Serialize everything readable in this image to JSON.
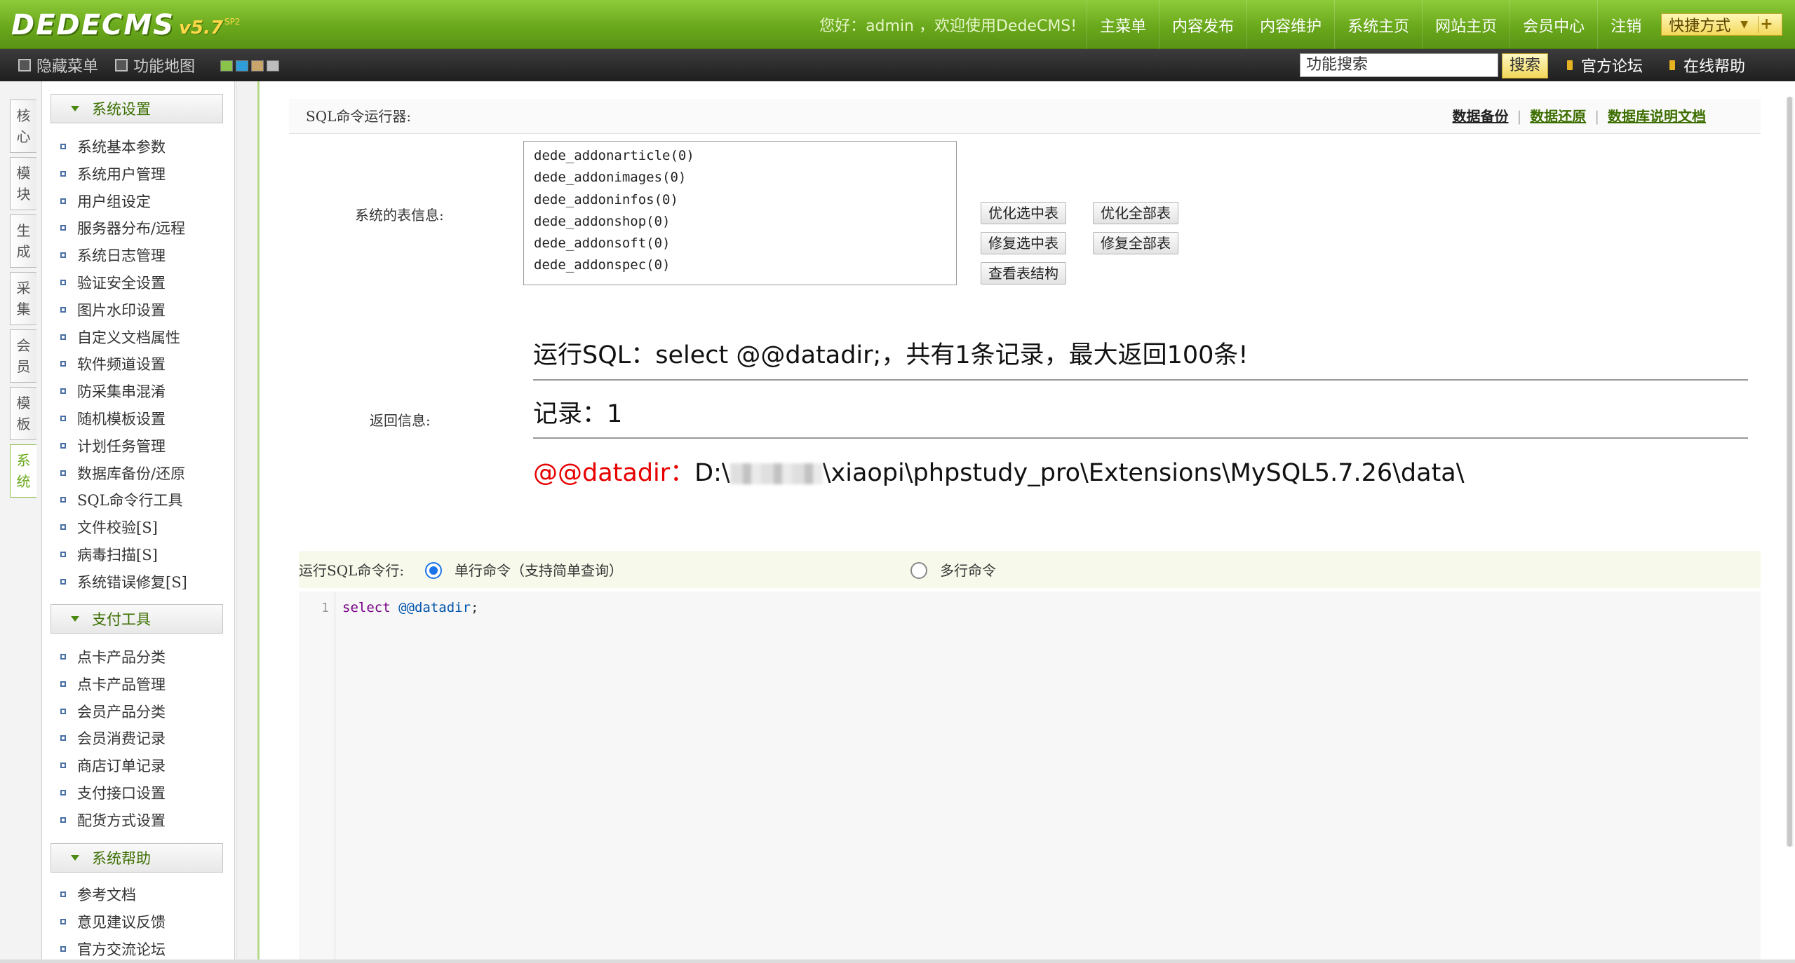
{
  "header": {
    "logo_text": "DEDECMS",
    "logo_version": "v5.7",
    "logo_sup": "SP2",
    "welcome": "您好：admin ，欢迎使用DedeCMS!",
    "nav": [
      "主菜单",
      "内容发布",
      "内容维护",
      "系统主页",
      "网站主页",
      "会员中心",
      "注销"
    ],
    "quick_label": "快捷方式"
  },
  "toolbar": {
    "hide_menu": "隐藏菜单",
    "func_map": "功能地图",
    "search_value": "功能搜索",
    "search_button": "搜索",
    "forum_link": "官方论坛",
    "help_link": "在线帮助",
    "swatch_colors": [
      "#8bc34a",
      "#2f9ed8",
      "#c9a56b",
      "#bdbdbd"
    ]
  },
  "vtabs": [
    "核心",
    "模块",
    "生成",
    "采集",
    "会员",
    "模板",
    "系统"
  ],
  "sidebar": {
    "sections": [
      {
        "title": "系统设置",
        "items": [
          "系统基本参数",
          "系统用户管理",
          "用户组设定",
          "服务器分布/远程",
          "系统日志管理",
          "验证安全设置",
          "图片水印设置",
          "自定义文档属性",
          "软件频道设置",
          "防采集串混淆",
          "随机模板设置",
          "计划任务管理",
          "数据库备份/还原",
          "SQL命令行工具",
          "文件校验[S]",
          "病毒扫描[S]",
          "系统错误修复[S]"
        ]
      },
      {
        "title": "支付工具",
        "items": [
          "点卡产品分类",
          "点卡产品管理",
          "会员产品分类",
          "会员消费记录",
          "商店订单记录",
          "支付接口设置",
          "配货方式设置"
        ]
      },
      {
        "title": "系统帮助",
        "items": [
          "参考文档",
          "意见建议反馈",
          "官方交流论坛"
        ]
      }
    ]
  },
  "main": {
    "title": "SQL命令运行器:",
    "links": [
      "数据备份",
      "数据还原",
      "数据库说明文档"
    ],
    "table_info_label": "系统的表信息:",
    "tables": [
      "dede_addonarticle(0)",
      "dede_addonimages(0)",
      "dede_addoninfos(0)",
      "dede_addonshop(0)",
      "dede_addonsoft(0)",
      "dede_addonspec(0)"
    ],
    "buttons": {
      "optimize_selected": "优化选中表",
      "optimize_all": "优化全部表",
      "repair_selected": "修复选中表",
      "repair_all": "修复全部表",
      "view_structure": "查看表结构"
    },
    "return_label": "返回信息:",
    "result_line1": "运行SQL：select @@datadir;，共有1条记录，最大返回100条!",
    "result_line2": "记录：1",
    "result_key": "@@datadir：",
    "result_val_prefix": "D:\\",
    "result_val_suffix": "\\xiaopi\\phpstudy_pro\\Extensions\\MySQL5.7.26\\data\\",
    "sql_label": "运行SQL命令行:",
    "mode_single": "单行命令（支持简单查询）",
    "mode_multi": "多行命令",
    "mode_selected": "single",
    "editor_line_number": "1",
    "editor_kw": "select",
    "editor_var": "@@datadir",
    "editor_tail": ";"
  }
}
